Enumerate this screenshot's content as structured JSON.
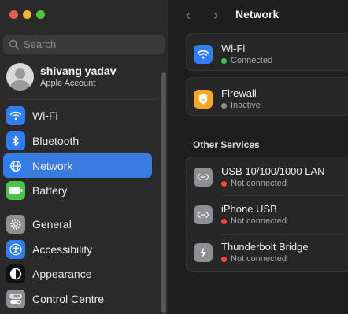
{
  "sidebar": {
    "search_placeholder": "Search",
    "account": {
      "name": "shivang yadav",
      "subtitle": "Apple Account"
    },
    "items": [
      {
        "label": "Wi-Fi",
        "icon": "wifi-icon",
        "color": "#2f7ef6"
      },
      {
        "label": "Bluetooth",
        "icon": "bluetooth-icon",
        "color": "#2f7ef6"
      },
      {
        "label": "Network",
        "icon": "globe-icon",
        "color": "#2f7ef6",
        "active": true
      },
      {
        "label": "Battery",
        "icon": "battery-icon",
        "color": "#4cc34a"
      },
      {
        "label": "General",
        "icon": "gear-icon",
        "color": "#8e8e93"
      },
      {
        "label": "Accessibility",
        "icon": "accessibility-icon",
        "color": "#2f7ef6"
      },
      {
        "label": "Appearance",
        "icon": "appearance-icon",
        "color": "#111111"
      },
      {
        "label": "Control Centre",
        "icon": "control-centre-icon",
        "color": "#8e8e93"
      }
    ]
  },
  "main": {
    "title": "Network",
    "wifi": {
      "title": "Wi-Fi",
      "status": "Connected",
      "status_color": "#30d158"
    },
    "firewall": {
      "title": "Firewall",
      "status": "Inactive",
      "status_color": "#8e8e93"
    },
    "other_services_title": "Other Services",
    "services": [
      {
        "title": "USB 10/100/1000 LAN",
        "status": "Not connected",
        "status_color": "#ff453a",
        "icon": "ethernet-icon"
      },
      {
        "title": "iPhone USB",
        "status": "Not connected",
        "status_color": "#ff453a",
        "icon": "ethernet-icon"
      },
      {
        "title": "Thunderbolt Bridge",
        "status": "Not connected",
        "status_color": "#ff453a",
        "icon": "thunderbolt-icon"
      }
    ]
  }
}
